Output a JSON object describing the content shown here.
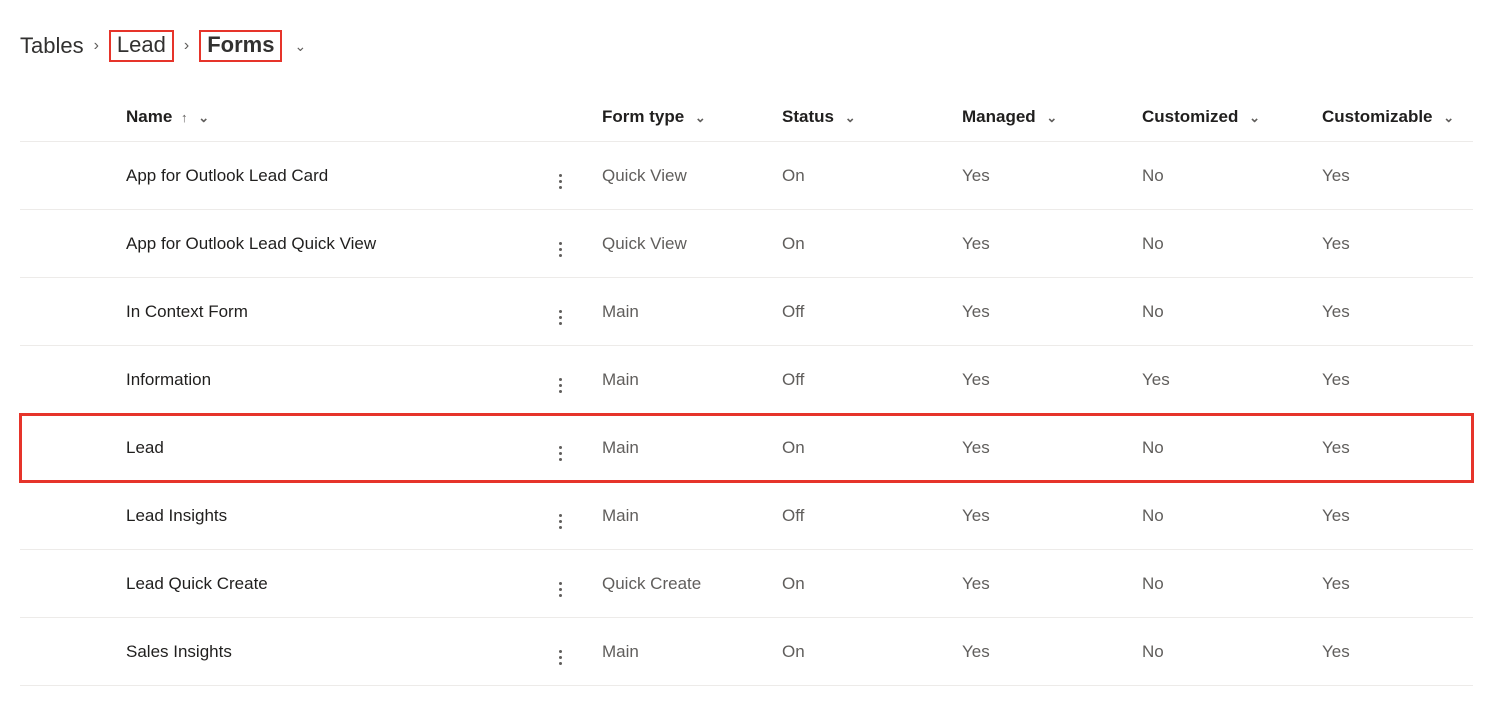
{
  "breadcrumb": {
    "tables": "Tables",
    "lead": "Lead",
    "forms": "Forms"
  },
  "columns": {
    "name": "Name",
    "form_type": "Form type",
    "status": "Status",
    "managed": "Managed",
    "customized": "Customized",
    "customizable": "Customizable"
  },
  "rows": [
    {
      "name": "App for Outlook Lead Card",
      "form_type": "Quick View",
      "status": "On",
      "managed": "Yes",
      "customized": "No",
      "customizable": "Yes",
      "highlight": false
    },
    {
      "name": "App for Outlook Lead Quick View",
      "form_type": "Quick View",
      "status": "On",
      "managed": "Yes",
      "customized": "No",
      "customizable": "Yes",
      "highlight": false
    },
    {
      "name": "In Context Form",
      "form_type": "Main",
      "status": "Off",
      "managed": "Yes",
      "customized": "No",
      "customizable": "Yes",
      "highlight": false
    },
    {
      "name": "Information",
      "form_type": "Main",
      "status": "Off",
      "managed": "Yes",
      "customized": "Yes",
      "customizable": "Yes",
      "highlight": false
    },
    {
      "name": "Lead",
      "form_type": "Main",
      "status": "On",
      "managed": "Yes",
      "customized": "No",
      "customizable": "Yes",
      "highlight": true
    },
    {
      "name": "Lead Insights",
      "form_type": "Main",
      "status": "Off",
      "managed": "Yes",
      "customized": "No",
      "customizable": "Yes",
      "highlight": false
    },
    {
      "name": "Lead Quick Create",
      "form_type": "Quick Create",
      "status": "On",
      "managed": "Yes",
      "customized": "No",
      "customizable": "Yes",
      "highlight": false
    },
    {
      "name": "Sales Insights",
      "form_type": "Main",
      "status": "On",
      "managed": "Yes",
      "customized": "No",
      "customizable": "Yes",
      "highlight": false
    }
  ]
}
